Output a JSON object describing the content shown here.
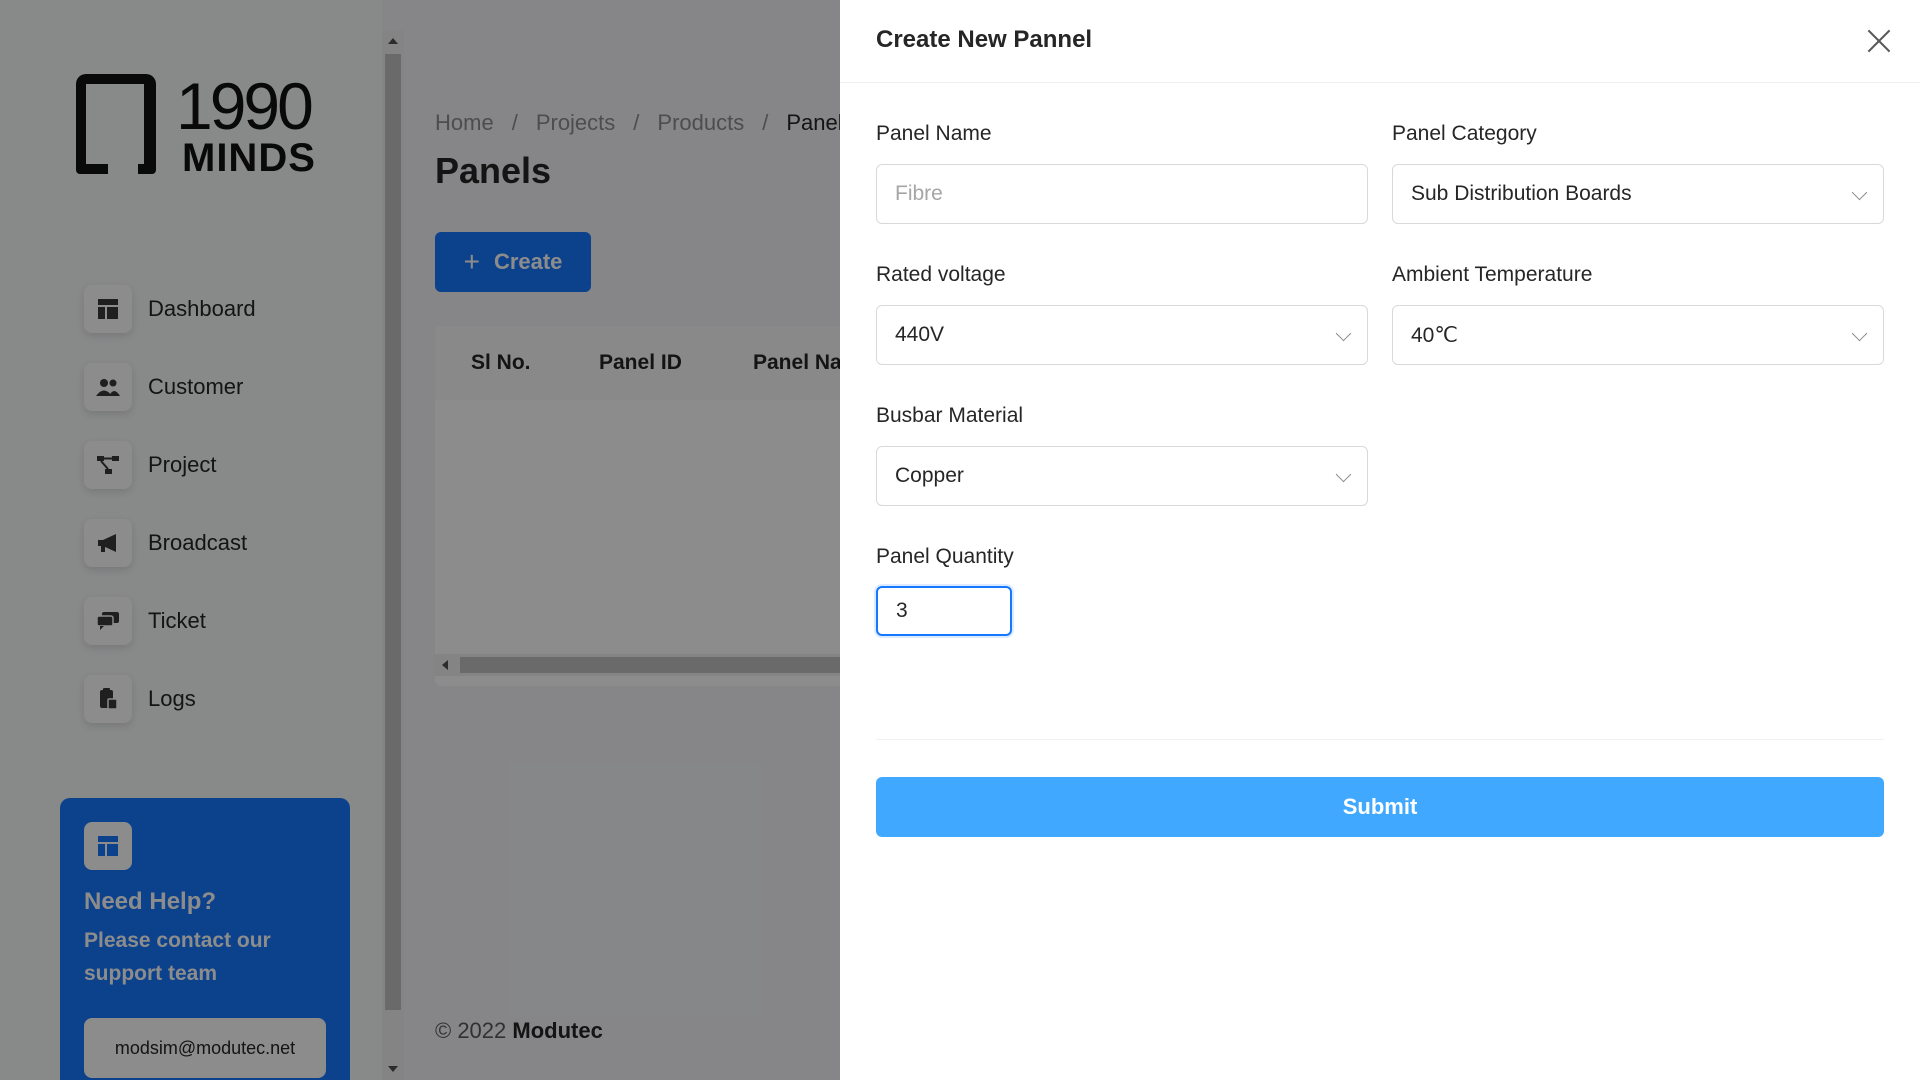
{
  "logo": {
    "number": "1990",
    "word": "MINDS"
  },
  "sidebar": {
    "items": [
      {
        "label": "Dashboard",
        "icon": "dashboard-icon"
      },
      {
        "label": "Customer",
        "icon": "customer-icon"
      },
      {
        "label": "Project",
        "icon": "project-icon"
      },
      {
        "label": "Broadcast",
        "icon": "broadcast-icon"
      },
      {
        "label": "Ticket",
        "icon": "ticket-icon"
      },
      {
        "label": "Logs",
        "icon": "logs-icon"
      }
    ],
    "help": {
      "title": "Need Help?",
      "text": "Please contact our support team",
      "email": "modsim@modutec.net"
    }
  },
  "main": {
    "breadcrumb": [
      "Home",
      "Projects",
      "Products",
      "Panels"
    ],
    "title": "Panels",
    "create_label": "Create",
    "table_headers": [
      "Sl No.",
      "Panel ID",
      "Panel Na"
    ],
    "footer_prefix": "© 2022",
    "footer_brand": "Modutec"
  },
  "drawer": {
    "title": "Create New Pannel",
    "panel_name": {
      "label": "Panel Name",
      "placeholder": "Fibre",
      "value": ""
    },
    "panel_category": {
      "label": "Panel Category",
      "value": "Sub Distribution Boards"
    },
    "rated_voltage": {
      "label": "Rated voltage",
      "value": "440V"
    },
    "ambient_temperature": {
      "label": "Ambient Temperature",
      "value": "40℃"
    },
    "busbar_material": {
      "label": "Busbar Material",
      "value": "Copper"
    },
    "panel_quantity": {
      "label": "Panel Quantity",
      "value": "3"
    },
    "submit_label": "Submit"
  },
  "colors": {
    "primary": "#1677ff",
    "submit": "#40a9ff",
    "overlay": "rgba(0,0,0,0.45)"
  }
}
